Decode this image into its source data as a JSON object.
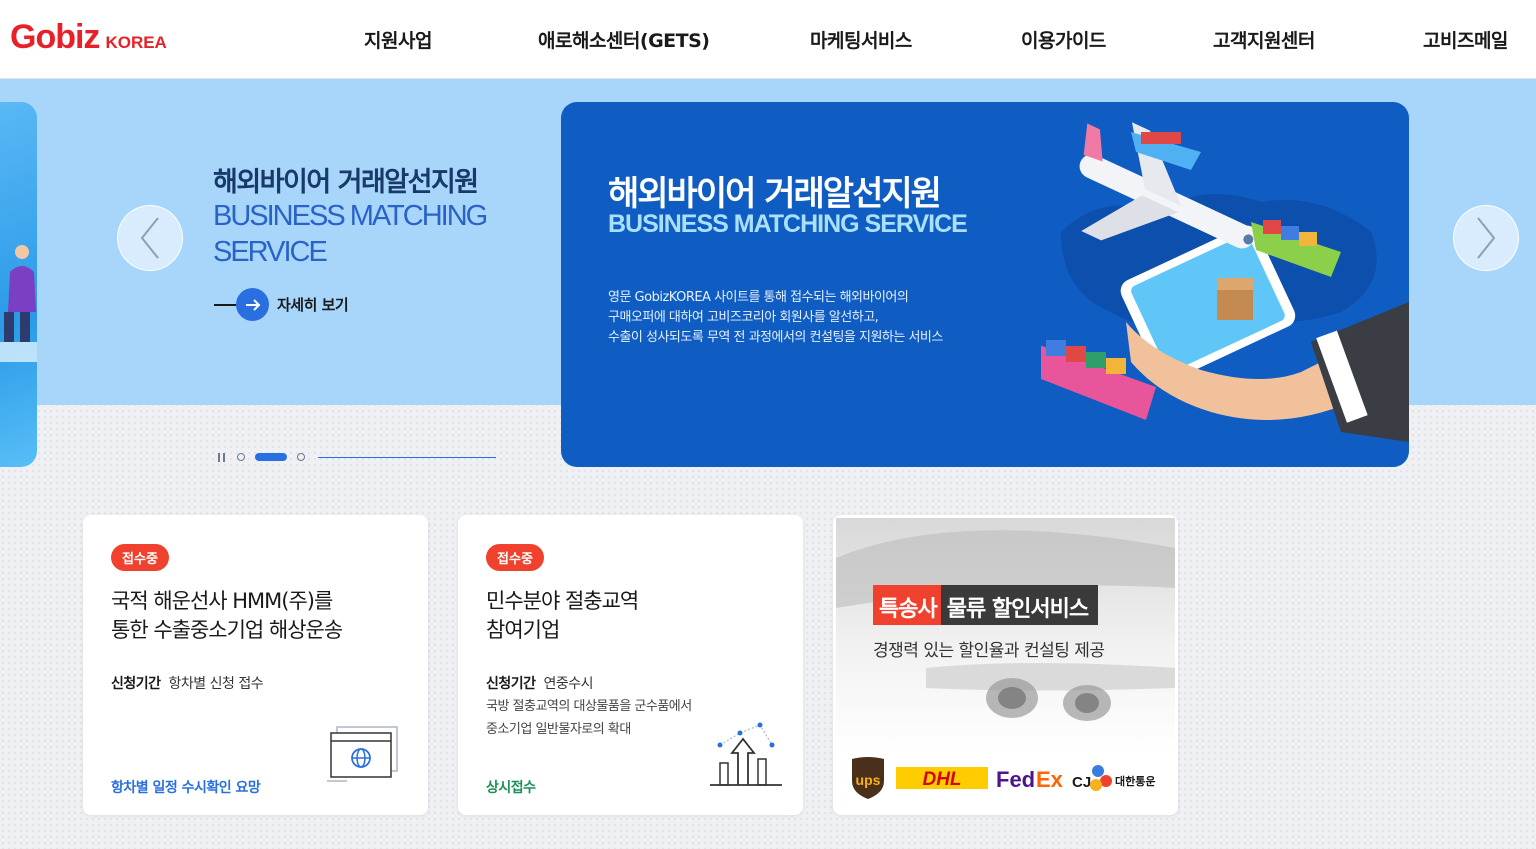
{
  "header": {
    "logo_main": "Gobiz",
    "logo_sub": "KOREA",
    "nav": [
      {
        "label": "지원사업"
      },
      {
        "label": "애로해소센터(GETS)"
      },
      {
        "label": "마케팅서비스"
      },
      {
        "label": "이용가이드"
      },
      {
        "label": "고객지원센터"
      },
      {
        "label": "고비즈메일"
      }
    ]
  },
  "hero": {
    "title_kr": "해외바이어 거래알선지원",
    "title_en_line1": "BUSINESS MATCHING",
    "title_en_line2": "SERVICE",
    "more_label": "자세히 보기",
    "pager": {
      "total": 3,
      "active": 2
    },
    "card": {
      "title": "해외바이어 거래알선지원",
      "subtitle": "BUSINESS MATCHING SERVICE",
      "desc": [
        "영문 GobizKOREA 사이트를 통해 접수되는 해외바이어의",
        "구매오퍼에 대하여 고비즈코리아 회원사를 알선하고,",
        "수출이 성사되도록 무역 전 과정에서의 컨설팅을 지원하는 서비스"
      ]
    }
  },
  "cards": [
    {
      "badge": "접수중",
      "title": [
        "국적 해운선사 HMM(주)를",
        "통한 수출중소기업 해상운송"
      ],
      "period_label": "신청기간",
      "period_value": "항차별 신청 접수",
      "desc": [],
      "footer": "항차별 일정 수시확인 요망",
      "footer_color": "#2a6fe0",
      "icon": "browser-globe-icon"
    },
    {
      "badge": "접수중",
      "title": [
        "민수분야 절충교역",
        "참여기업"
      ],
      "period_label": "신청기간",
      "period_value": "연중수시",
      "desc": [
        "국방 절충교역의 대상물품을 군수품에서",
        "중소기업 일반물자로의 확대"
      ],
      "footer": "상시접수",
      "footer_color": "#1f8f5a",
      "icon": "growth-chart-icon"
    }
  ],
  "promo": {
    "headline_red": "특송사",
    "headline_dark": "물류 할인서비스",
    "subtitle": "경쟁력 있는 할인율과 컨설팅 제공",
    "logos": [
      "UPS",
      "DHL",
      "FedEx",
      "CJ 대한통운"
    ]
  },
  "colors": {
    "brand_red": "#e8202a",
    "accent_blue": "#2a6fe0",
    "hero_card_blue": "#0f5cc2",
    "hero_band": "#a8d6fb",
    "badge_red": "#f0412e"
  }
}
